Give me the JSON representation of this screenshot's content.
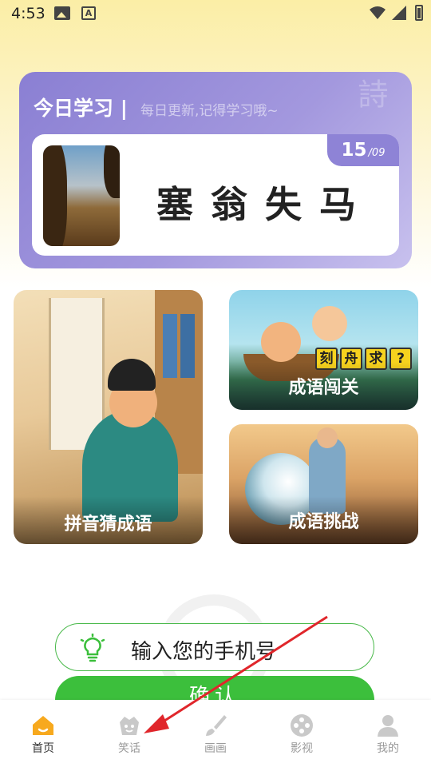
{
  "status_bar": {
    "time": "4:53"
  },
  "daily": {
    "title": "今日学习 |",
    "subtitle": "每日更新,记得学习哦~",
    "idiom": "塞翁失马",
    "date_day": "15",
    "date_month": "/09",
    "bg_glyph": "詩"
  },
  "cards": {
    "pinyin": "拼音猜成语",
    "level": "成语闯关",
    "challenge": "成语挑战",
    "tiles": [
      "刻",
      "舟",
      "求",
      "?"
    ]
  },
  "login": {
    "phone_placeholder": "输入您的手机号",
    "confirm": "确认"
  },
  "nav": {
    "items": [
      {
        "label": "首页",
        "icon": "home-icon"
      },
      {
        "label": "笑话",
        "icon": "joke-icon"
      },
      {
        "label": "画画",
        "icon": "brush-icon"
      },
      {
        "label": "影视",
        "icon": "film-icon"
      },
      {
        "label": "我的",
        "icon": "user-icon"
      }
    ]
  },
  "colors": {
    "accent_green": "#3cbf3c",
    "card_purple": "#8a7fd3",
    "nav_home_orange": "#f7a91e"
  }
}
